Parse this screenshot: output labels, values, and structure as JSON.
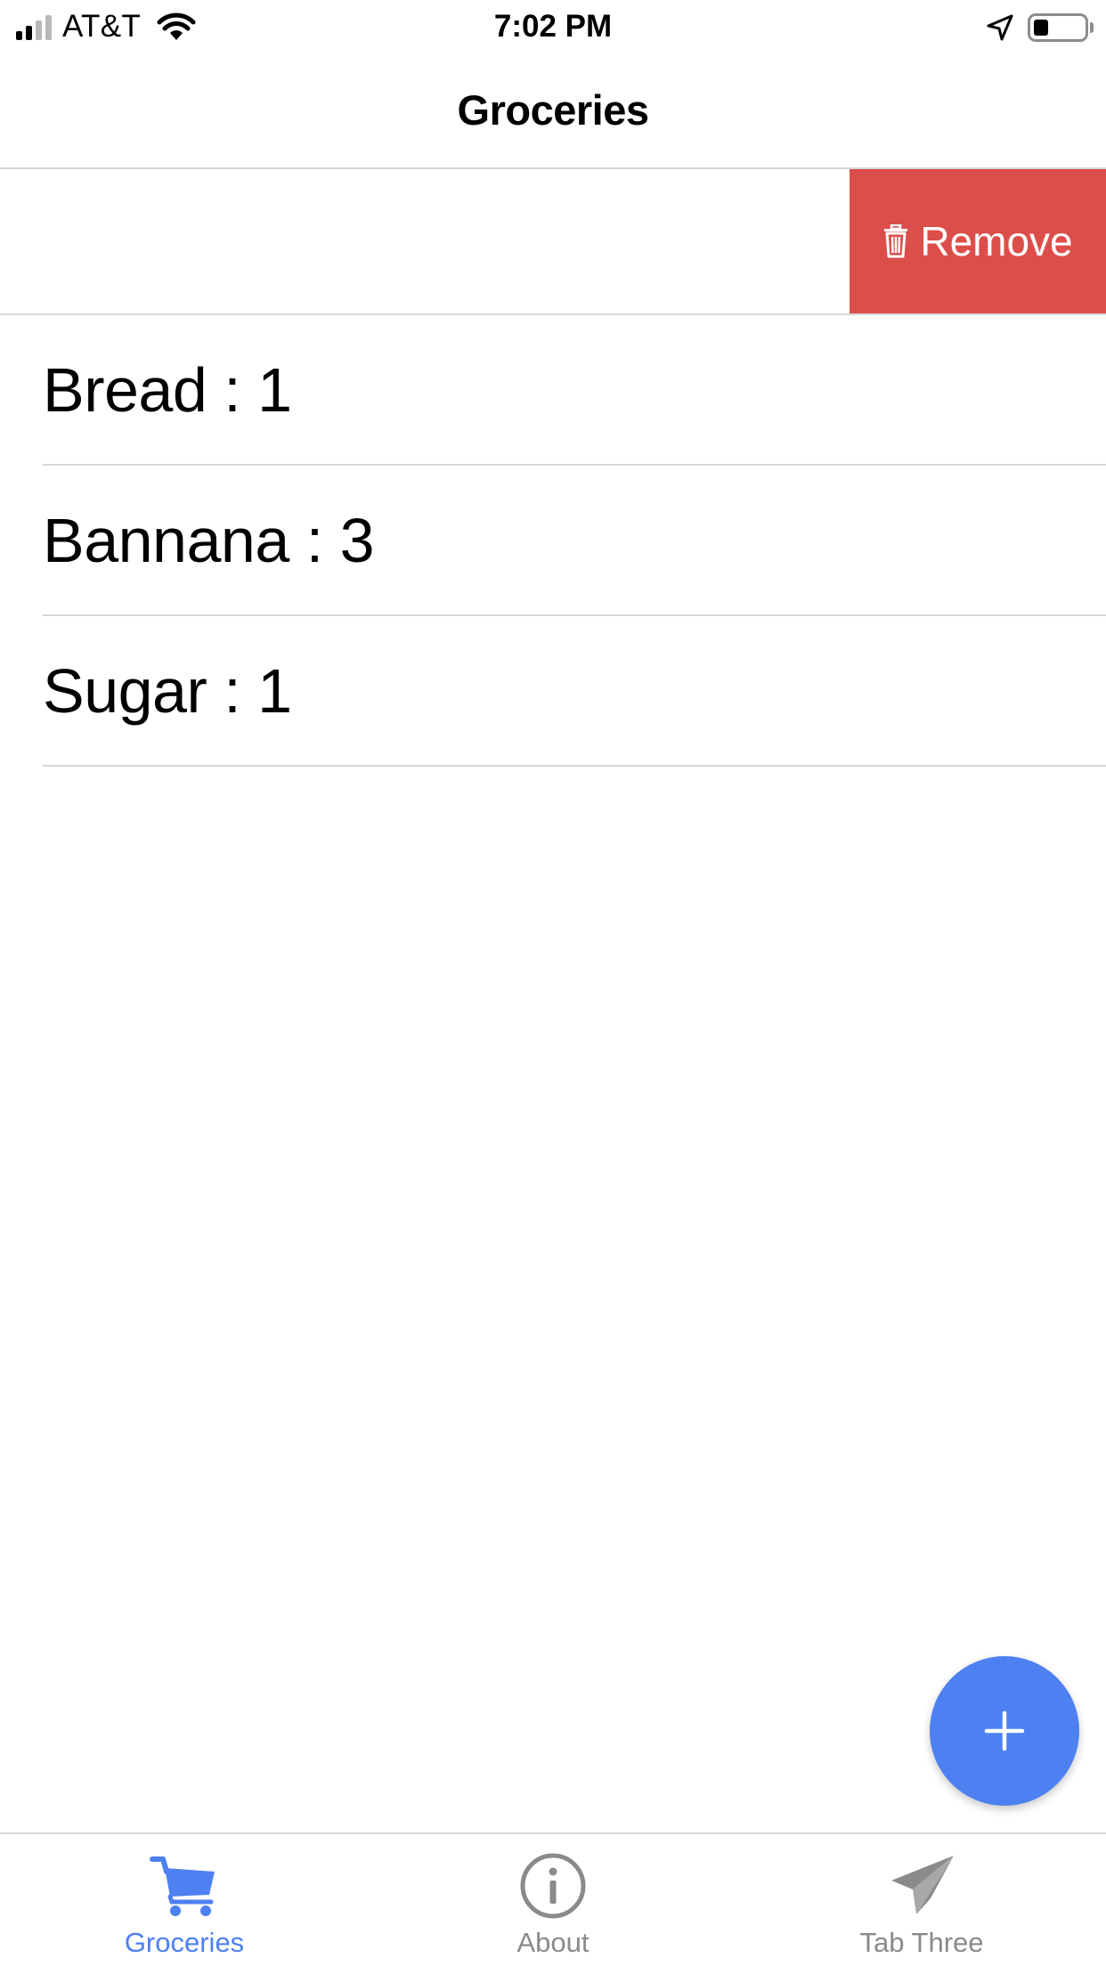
{
  "status_bar": {
    "carrier": "AT&T",
    "time": "7:02 PM",
    "battery_level": 0.3
  },
  "nav": {
    "title": "Groceries"
  },
  "swipe_action": {
    "label": "Remove",
    "icon": "trash-icon",
    "color": "#dc4e4a"
  },
  "groceries": [
    {
      "label": "Bread : 1"
    },
    {
      "label": "Bannana : 3"
    },
    {
      "label": "Sugar : 1"
    }
  ],
  "fab": {
    "icon": "plus-icon",
    "color": "#4d80f0"
  },
  "tabs": [
    {
      "label": "Groceries",
      "icon": "cart-icon",
      "active": true
    },
    {
      "label": "About",
      "icon": "info-icon",
      "active": false
    },
    {
      "label": "Tab Three",
      "icon": "paper-plane-icon",
      "active": false
    }
  ],
  "colors": {
    "accent": "#4d80f0",
    "inactive": "#8a8a8a",
    "destructive": "#dc4e4a"
  }
}
